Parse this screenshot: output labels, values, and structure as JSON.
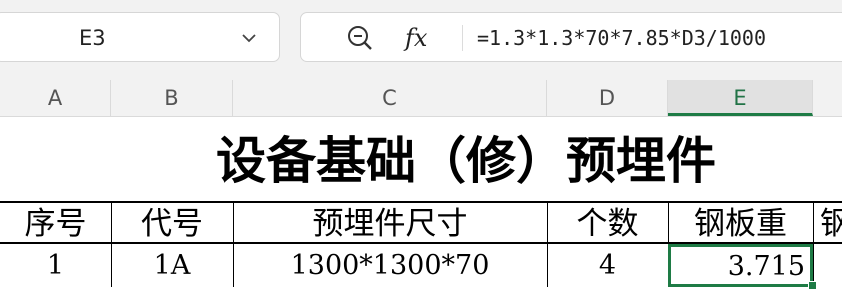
{
  "formula_bar": {
    "cell_reference": "E3",
    "fx_label": "fx",
    "formula": "=1.3*1.3*70*7.85*D3/1000"
  },
  "columns": [
    "A",
    "B",
    "C",
    "D",
    "E"
  ],
  "selected_column": "E",
  "sheet": {
    "title": "设备基础（修）预埋件",
    "headers": [
      "序号",
      "代号",
      "预埋件尺寸",
      "个数",
      "钢板重",
      "钢"
    ],
    "row": {
      "no": "1",
      "code": "1A",
      "size": "1300*1300*70",
      "count": "4",
      "steel_weight": "3.715"
    }
  },
  "colors": {
    "toolbar_bg": "#f2f2f2",
    "selection": "#1e7b45"
  }
}
